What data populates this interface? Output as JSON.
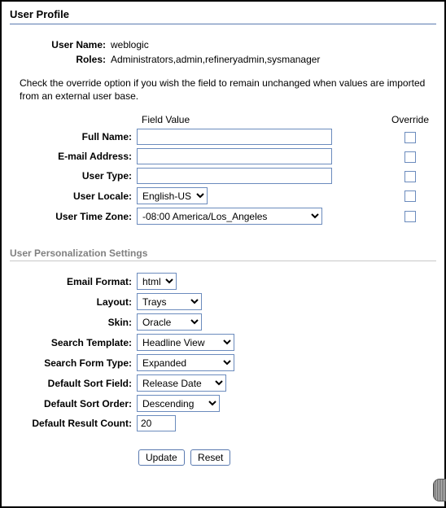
{
  "title": "User Profile",
  "info": {
    "username_label": "User Name:",
    "username_value": "weblogic",
    "roles_label": "Roles:",
    "roles_value": "Administrators,admin,refineryadmin,sysmanager"
  },
  "instructions": "Check the override option if you wish the field to remain unchanged when values are imported from an external user base.",
  "headers": {
    "field_value": "Field Value",
    "override": "Override"
  },
  "fields": {
    "full_name": {
      "label": "Full Name:",
      "value": ""
    },
    "email": {
      "label": "E-mail Address:",
      "value": ""
    },
    "user_type": {
      "label": "User Type:",
      "value": ""
    },
    "locale": {
      "label": "User Locale:",
      "value": "English-US"
    },
    "timezone": {
      "label": "User Time Zone:",
      "value": "-08:00 America/Los_Angeles"
    }
  },
  "section2_title": "User Personalization Settings",
  "prefs": {
    "email_format": {
      "label": "Email Format:",
      "value": "html"
    },
    "layout": {
      "label": "Layout:",
      "value": "Trays"
    },
    "skin": {
      "label": "Skin:",
      "value": "Oracle"
    },
    "search_template": {
      "label": "Search Template:",
      "value": "Headline View"
    },
    "search_form_type": {
      "label": "Search Form Type:",
      "value": "Expanded"
    },
    "default_sort_field": {
      "label": "Default Sort Field:",
      "value": "Release Date"
    },
    "default_sort_order": {
      "label": "Default Sort Order:",
      "value": "Descending"
    },
    "default_result_count": {
      "label": "Default Result Count:",
      "value": "20"
    }
  },
  "buttons": {
    "update": "Update",
    "reset": "Reset"
  }
}
